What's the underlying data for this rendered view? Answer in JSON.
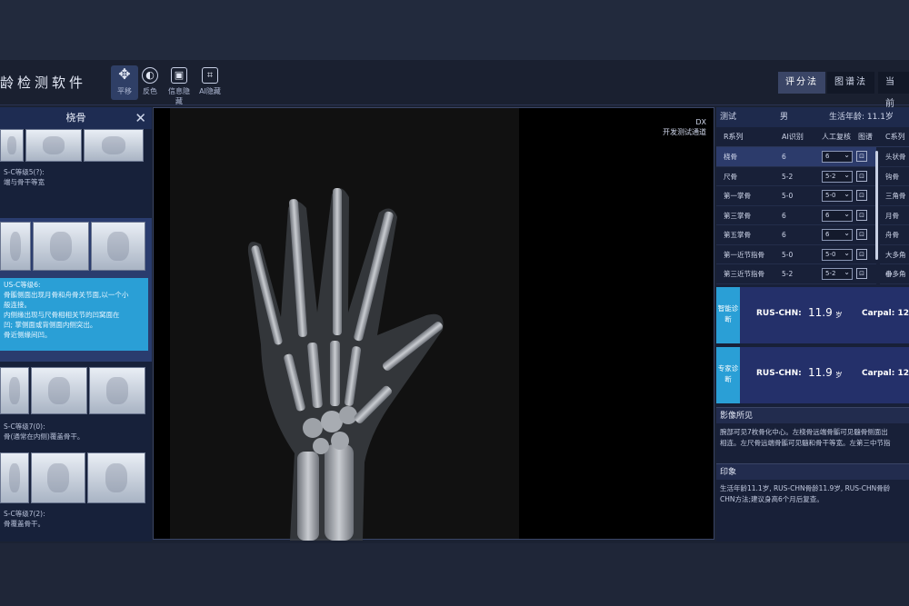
{
  "app": {
    "title": "龄检测软件"
  },
  "toolbar": {
    "tools": [
      {
        "label": "平移",
        "icon": "move-icon"
      },
      {
        "label": "反色",
        "icon": "invert-icon"
      },
      {
        "label": "信息隐藏",
        "icon": "hide-info-icon"
      },
      {
        "label": "AI隐藏",
        "icon": "ai-hide-icon"
      }
    ],
    "modes": [
      "评分法",
      "图谱法",
      "当前"
    ]
  },
  "left_panel": {
    "title": "桡骨",
    "blocks": [
      {
        "text": [
          "S-C等级5(?):",
          "端与骨干等宽"
        ]
      },
      {
        "text": [
          "US-C等级6:",
          "骨骺侧面出现月骨和舟骨关节面,以一个小",
          "般连接。",
          "内侧缘出现与尺骨相相关节的凹窝面在",
          "凹; 掌侧面或背侧面内侧突出。",
          "骨近侧缘间凹。"
        ]
      },
      {
        "text": [
          "S-C等级7(0):",
          "骨(通常在内侧)覆盖骨干。"
        ]
      },
      {
        "text": [
          "S-C等级7(2):",
          "骨覆盖骨干。"
        ]
      }
    ]
  },
  "viewer": {
    "tag_line1": "DX",
    "tag_line2": "开发测试通道"
  },
  "right_panel": {
    "info": {
      "label": "测试",
      "sex": "男",
      "age": "生活年龄: 11.1岁"
    },
    "columns": {
      "r": "R系列",
      "ai": "AI识别",
      "manual": "人工复核",
      "atlas": "图谱",
      "c": "C系列"
    },
    "rows": [
      {
        "name": "桡骨",
        "ai": "6",
        "manual": "6"
      },
      {
        "name": "尺骨",
        "ai": "5-2",
        "manual": "5-2"
      },
      {
        "name": "第一掌骨",
        "ai": "5-0",
        "manual": "5-0"
      },
      {
        "name": "第三掌骨",
        "ai": "6",
        "manual": "6"
      },
      {
        "name": "第五掌骨",
        "ai": "6",
        "manual": "6"
      },
      {
        "name": "第一近节指骨",
        "ai": "5-0",
        "manual": "5-0"
      },
      {
        "name": "第三近节指骨",
        "ai": "5-2",
        "manual": "5-2"
      }
    ],
    "c_items": [
      "头状骨",
      "钩骨",
      "三角骨",
      "月骨",
      "舟骨",
      "大多角骨",
      "小多角骨"
    ],
    "diagnoses": [
      {
        "tag": "智能诊断",
        "label": "RUS-CHN:",
        "value": "11.9",
        "unit": "岁",
        "label2": "Carpal: 12"
      },
      {
        "tag": "专家诊断",
        "label": "RUS-CHN:",
        "value": "11.9",
        "unit": "岁",
        "label2": "Carpal: 12"
      }
    ],
    "findings": {
      "title": "影像所见",
      "body": [
        "腕部可见7枚骨化中心。左桡骨远端骨骺可见髓骨侧面出",
        "相连。左尺骨远端骨骺可见髓和骨干等宽。左第三中节指"
      ]
    },
    "impression": {
      "title": "印象",
      "body": [
        "生活年龄11.1岁, RUS-CHN骨龄11.9岁, RUS-CHN骨龄",
        "CHN方法;建议身高6个月后复查。"
      ]
    }
  }
}
